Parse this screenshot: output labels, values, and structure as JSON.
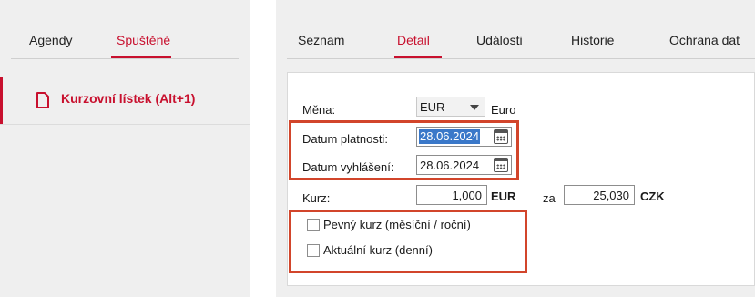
{
  "left_tabs": [
    {
      "label": "Agendy",
      "underline_char": "g",
      "pre": "A",
      "post": "endy"
    },
    {
      "label": "Spuštěné",
      "pre": "",
      "underline_char": "Spuštěné",
      "post": ""
    }
  ],
  "sidebar": {
    "item_label": "Kurzovní lístek (Alt+1)",
    "icon": "document-icon"
  },
  "right_tabs": [
    {
      "pre": "Se",
      "underline_char": "z",
      "post": "nam"
    },
    {
      "pre": "",
      "underline_char": "D",
      "post": "etail"
    },
    {
      "pre": "Události",
      "underline_char": "",
      "post": ""
    },
    {
      "pre": "",
      "underline_char": "H",
      "post": "istorie"
    },
    {
      "pre": "Ochrana dat",
      "underline_char": "",
      "post": ""
    }
  ],
  "form": {
    "currency_label": "Měna:",
    "currency_value": "EUR",
    "currency_name": "Euro",
    "valid_date_label": "Datum platnosti:",
    "valid_date_value": "28.06.2024",
    "announce_date_label": "Datum vyhlášení:",
    "announce_date_value": "28.06.2024",
    "rate_label": "Kurz:",
    "rate_amount": "1,000",
    "rate_currency": "EUR",
    "rate_for": "za",
    "rate_value": "25,030",
    "rate_target": "CZK",
    "fixed_rate_label": "Pevný kurz (měsíční / roční)",
    "current_rate_label": "Aktuální kurz (denní)",
    "fixed_rate_checked": false,
    "current_rate_checked": false
  },
  "colors": {
    "accent": "#c8102e",
    "highlight_box": "#d2452b",
    "selection": "#3a78c9"
  }
}
